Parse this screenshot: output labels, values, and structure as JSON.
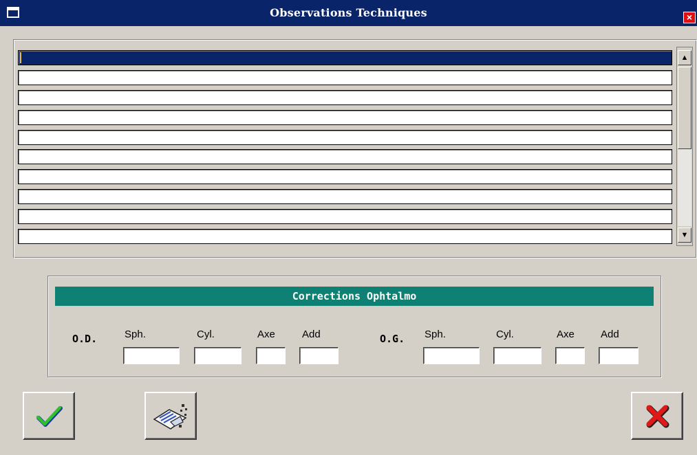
{
  "window": {
    "title": "Observations Techniques",
    "close_glyph": "×"
  },
  "observations": {
    "row_count": 10,
    "selected_index": 0,
    "rows": [
      "",
      "",
      "",
      "",
      "",
      "",
      "",
      "",
      "",
      ""
    ]
  },
  "scrollbar": {
    "up_glyph": "▲",
    "down_glyph": "▼"
  },
  "corrections": {
    "header": "Corrections Ophtalmo",
    "od": {
      "label": "O.D.",
      "sph_label": "Sph.",
      "cyl_label": "Cyl.",
      "axe_label": "Axe",
      "add_label": "Add",
      "sph": "",
      "cyl": "",
      "axe": "",
      "add": ""
    },
    "og": {
      "label": "O.G.",
      "sph_label": "Sph.",
      "cyl_label": "Cyl.",
      "axe_label": "Axe",
      "add_label": "Add",
      "sph": "",
      "cyl": "",
      "axe": "",
      "add": ""
    }
  },
  "buttons": {
    "ok_icon": "checkmark-icon",
    "clear_icon": "eraser-icon",
    "cancel_icon": "red-x-icon"
  },
  "colors": {
    "titlebar": "#0a246a",
    "selection": "#0a246a",
    "section_header": "#0e8074",
    "background": "#d4d0c8"
  }
}
